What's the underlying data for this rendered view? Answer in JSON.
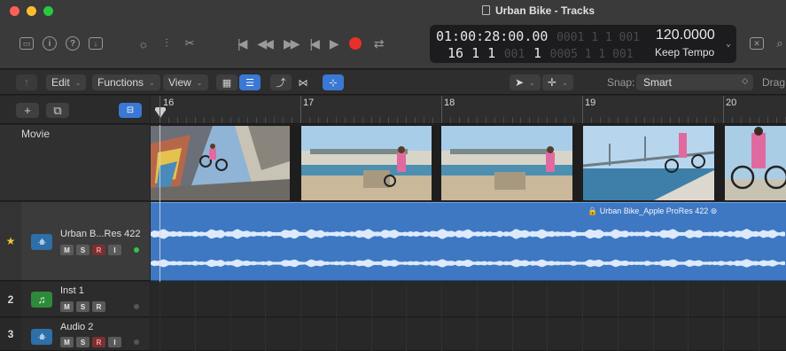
{
  "window": {
    "title": "Urban Bike - Tracks"
  },
  "lcd": {
    "time_code": "01:00:28:00.00",
    "time_code_dim": "0001 1 1 001",
    "position": "16 1 1",
    "position_sub": "1",
    "position_dim": "0005 1 1 001",
    "tempo": "120.0000",
    "tempo_mode": "Keep Tempo"
  },
  "toolbar": {
    "edit_label": "Edit",
    "functions_label": "Functions",
    "view_label": "View",
    "snap_label": "Snap:",
    "snap_value": "Smart",
    "drag_label": "Drag:"
  },
  "ruler": {
    "bars": [
      "16",
      "17",
      "18",
      "19",
      "20"
    ]
  },
  "tracks": {
    "movie_label": "Movie",
    "items": [
      {
        "number": "",
        "name": "Urban B...Res 422",
        "type": "audio",
        "buttons": [
          "M",
          "S",
          "R",
          "I"
        ]
      },
      {
        "number": "2",
        "name": "Inst 1",
        "type": "instrument",
        "buttons": [
          "M",
          "S",
          "R"
        ]
      },
      {
        "number": "3",
        "name": "Audio 2",
        "type": "audio",
        "buttons": [
          "M",
          "S",
          "R",
          "I"
        ]
      }
    ]
  },
  "region": {
    "name": "Urban Bike_Apple ProRes 422"
  },
  "colors": {
    "accent": "#3a78d4",
    "region": "#3e78c2",
    "record": "#e8302a",
    "star": "#f2c230"
  }
}
